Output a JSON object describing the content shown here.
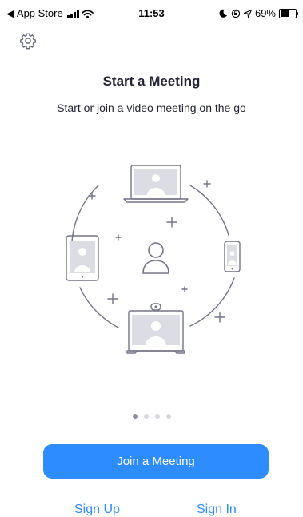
{
  "status_bar": {
    "back_app": "◀ App Store",
    "time": "11:53",
    "battery": "69%",
    "battery_level": 0.69,
    "icons": [
      "signal-bars-icon",
      "wifi-icon",
      "moon-icon",
      "rotation-lock-icon",
      "location-arrow-icon",
      "battery-icon"
    ]
  },
  "header": {
    "settings_icon": "gear-icon"
  },
  "main": {
    "title": "Start a Meeting",
    "subtitle": "Start or join a video meeting on the go",
    "illustration_icons": [
      "laptop-icon",
      "tablet-icon",
      "phone-icon",
      "room-camera-icon",
      "person-icon"
    ]
  },
  "pager": {
    "total": 4,
    "active_index": 0
  },
  "actions": {
    "join_label": "Join a Meeting",
    "sign_up_label": "Sign Up",
    "sign_in_label": "Sign In"
  },
  "colors": {
    "accent": "#2D8CFF",
    "text": "#232333",
    "illustration": "#747487"
  }
}
